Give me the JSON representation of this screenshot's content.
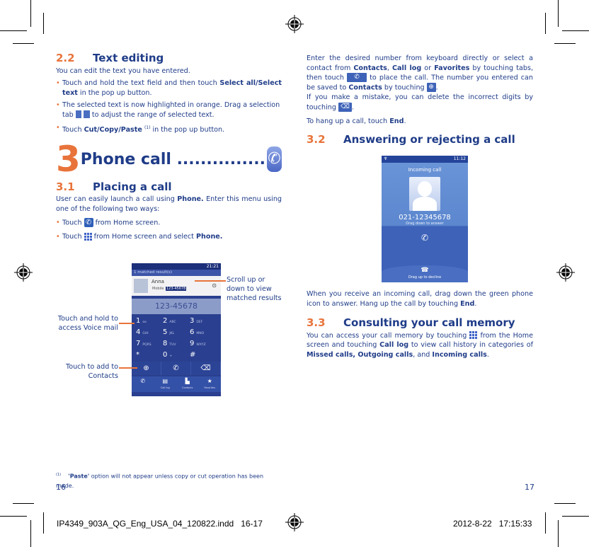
{
  "left_page": {
    "section_2_2": {
      "number": "2.2",
      "title": "Text editing",
      "intro": "You can edit the text you have entered.",
      "bullets": [
        {
          "pre": "Touch and hold the text field and then touch ",
          "bold": "Select all/Select text",
          "post": " in the pop up button."
        },
        {
          "pre": "The selected text is now highlighted in orange. Drag a selection tab ",
          "icon": "selection-tab-icon",
          "post": " to adjust the range of selected text."
        },
        {
          "pre": "Touch ",
          "bold": "Cut/Copy/Paste",
          "sup": "(1)",
          "post": " in the pop up button."
        }
      ]
    },
    "chapter": {
      "number": "3",
      "title": "Phone call ...............",
      "icon": "phone-app-icon"
    },
    "section_3_1": {
      "number": "3.1",
      "title": "Placing a call",
      "intro_pre": "User can easily launch a call using ",
      "intro_bold": "Phone.",
      "intro_post": " Enter this menu using one of the following two ways:",
      "bullets": [
        {
          "pre": "Touch ",
          "icon": "phone-icon",
          "post": " from Home screen."
        },
        {
          "pre": "Touch ",
          "icon": "app-grid-icon",
          "post": " from Home screen and select ",
          "bold": "Phone."
        }
      ]
    },
    "dialer_figure": {
      "status_time": "21:21",
      "matched": "1 matched result(s)",
      "contact_name": "Anna",
      "contact_label": "Mobile",
      "contact_number": "123-45678",
      "display": "123-45678",
      "keys": [
        {
          "digit": "1",
          "letters": "oo"
        },
        {
          "digit": "2",
          "letters": "ABC"
        },
        {
          "digit": "3",
          "letters": "DEF"
        },
        {
          "digit": "4",
          "letters": "GHI"
        },
        {
          "digit": "5",
          "letters": "JKL"
        },
        {
          "digit": "6",
          "letters": "MNO"
        },
        {
          "digit": "7",
          "letters": "PQRS"
        },
        {
          "digit": "8",
          "letters": "TUV"
        },
        {
          "digit": "9",
          "letters": "WXYZ"
        },
        {
          "digit": "*",
          "letters": ""
        },
        {
          "digit": "0",
          "letters": "+"
        },
        {
          "digit": "#",
          "letters": ""
        }
      ],
      "tabs": [
        {
          "icon": "phone-tab-icon",
          "label": ""
        },
        {
          "icon": "call-log-icon",
          "label": "Call log"
        },
        {
          "icon": "contacts-icon",
          "label": "Contacts"
        },
        {
          "icon": "star-icon",
          "label": "Favorites"
        }
      ],
      "callouts": {
        "scroll": "Scroll up or down to view matched results",
        "voicemail": "Touch and hold to access Voice mail",
        "add_contact": "Touch to add to Contacts"
      }
    },
    "footnote": {
      "marker": "(1)",
      "bold": "'Paste'",
      "text": " option will not appear unless copy or cut operation has been made."
    },
    "page_number": "16"
  },
  "right_page": {
    "para1": {
      "t1": "Enter the desired number from keyboard directly or select a contact from ",
      "b1": "Contacts",
      "t2": ", ",
      "b2": "Call log",
      "t3": " or ",
      "b3": "Favorites",
      "t4": " by touching tabs, then touch ",
      "t5": " to place the call. The number you entered can be saved to ",
      "b4": "Contacts",
      "t6": " by touching ",
      "t7": ".",
      "t8": "If you make a mistake, you can delete the incorrect digits by touching ",
      "t9": "."
    },
    "hangup": {
      "pre": "To hang up a call, touch ",
      "bold": "End",
      "post": "."
    },
    "section_3_2": {
      "number": "3.2",
      "title": "Answering or rejecting a call"
    },
    "incoming_figure": {
      "status_time": "11:12",
      "title": "Incoming call",
      "number": "021-12345678",
      "answer_hint": "Drag down to answer",
      "decline_hint": "Drag up to decline"
    },
    "para_incoming": {
      "pre": "When you receive an incoming call, drag down the green phone icon to answer. Hang up the call by touching ",
      "bold": "End",
      "post": "."
    },
    "section_3_3": {
      "number": "3.3",
      "title": "Consulting your call memory"
    },
    "para_memory": {
      "t1": "You can access your call memory by touching ",
      "t2": " from the Home screen and touching ",
      "b1": "Call log",
      "t3": " to view call history in categories of ",
      "b2": "Missed calls, Outgoing calls",
      "t4": ", and ",
      "b3": "Incoming calls",
      "t5": "."
    },
    "page_number": "17"
  },
  "slug": {
    "filename": "IP4349_903A_QG_Eng_USA_04_120822.indd   16-17",
    "timestamp": "2012-8-22   17:15:33"
  },
  "colors": {
    "text": "#1f3c88",
    "accent": "#e8743b"
  }
}
